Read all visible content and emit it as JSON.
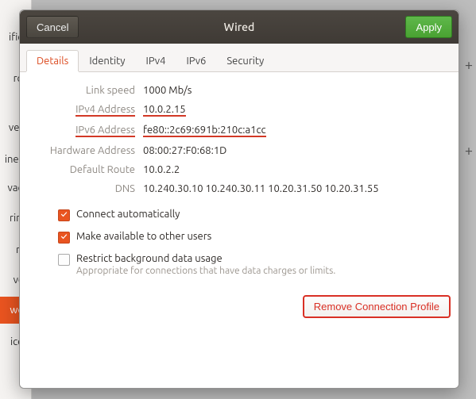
{
  "dialog": {
    "title": "Wired",
    "cancel": "Cancel",
    "apply": "Apply"
  },
  "tabs": {
    "details": "Details",
    "identity": "Identity",
    "ipv4": "IPv4",
    "ipv6": "IPv6",
    "security": "Security"
  },
  "details": {
    "link_speed_label": "Link speed",
    "link_speed_value": "1000 Mb/s",
    "ipv4_label": "IPv4 Address",
    "ipv4_value": "10.0.2.15",
    "ipv6_label": "IPv6 Address",
    "ipv6_value": "fe80::2c69:691b:210c:a1cc",
    "hw_label": "Hardware Address",
    "hw_value": "08:00:27:F0:68:1D",
    "route_label": "Default Route",
    "route_value": "10.0.2.2",
    "dns_label": "DNS",
    "dns_value": "10.240.30.10 10.240.30.11 10.20.31.50 10.20.31.55"
  },
  "checks": {
    "auto": "Connect automatically",
    "avail": "Make available to other users",
    "restrict": "Restrict background data usage",
    "restrict_sub": "Appropriate for connections that have data charges or limits."
  },
  "footer": {
    "remove": "Remove Connection Profile"
  },
  "bg": {
    "i0": "ifica",
    "i1": "rch",
    "i2": "vers",
    "i3": "ine A",
    "i4": "vacy",
    "i5": "ring",
    "i6": "nd",
    "i7": "ver",
    "i8": "wor",
    "i9": "ices"
  }
}
